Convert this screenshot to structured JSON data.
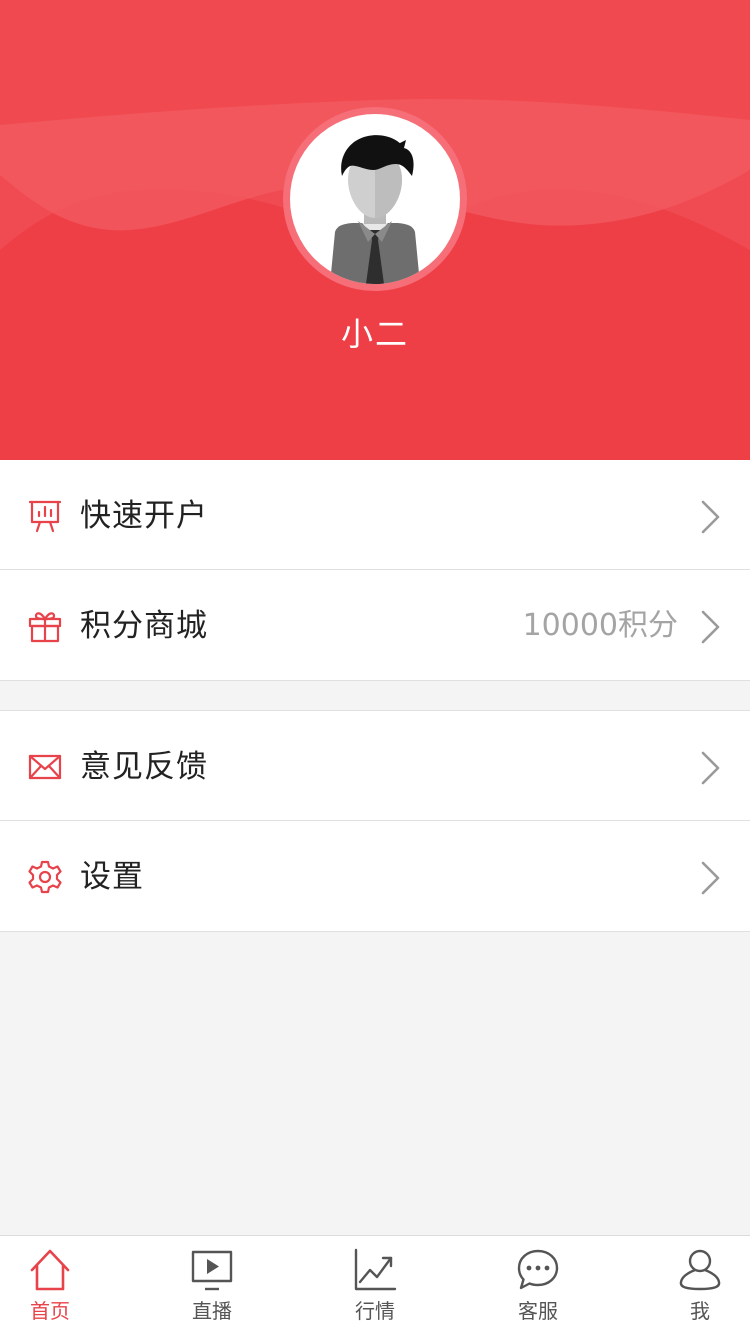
{
  "colors": {
    "header_bg": "#ee3f47",
    "accent": "#e8424a",
    "page_bg": "#f4f4f4",
    "label_text": "#222222",
    "muted_text": "#a4a4a4"
  },
  "profile": {
    "username": "小二",
    "avatar_icon": "default-user-avatar"
  },
  "menu": {
    "groups": [
      {
        "items": [
          {
            "label": "快速开户",
            "icon": "presentation-chart-icon",
            "value": ""
          },
          {
            "label": "积分商城",
            "icon": "gift-icon",
            "value": "10000积分"
          }
        ]
      },
      {
        "items": [
          {
            "label": "意见反馈",
            "icon": "envelope-icon",
            "value": ""
          },
          {
            "label": "设置",
            "icon": "gear-icon",
            "value": ""
          }
        ]
      }
    ]
  },
  "tabbar": {
    "active_index": 0,
    "tabs": [
      {
        "label": "首页",
        "icon": "home-icon"
      },
      {
        "label": "直播",
        "icon": "live-play-icon"
      },
      {
        "label": "行情",
        "icon": "trend-chart-icon"
      },
      {
        "label": "客服",
        "icon": "chat-bubble-icon"
      },
      {
        "label": "我",
        "icon": "user-icon"
      }
    ]
  }
}
